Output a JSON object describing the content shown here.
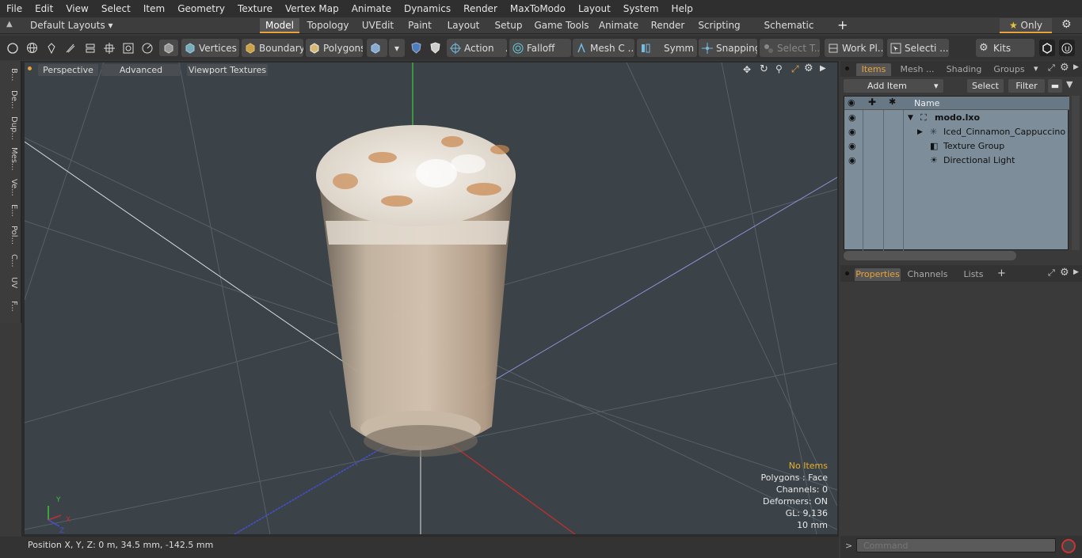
{
  "menu": [
    "File",
    "Edit",
    "View",
    "Select",
    "Item",
    "Geometry",
    "Texture",
    "Vertex Map",
    "Animate",
    "Dynamics",
    "Render",
    "MaxToModo",
    "Layout",
    "System",
    "Help"
  ],
  "layout": {
    "dropdown": "Default Layouts",
    "tabs": [
      "Model",
      "Topology",
      "UVEdit",
      "Paint",
      "Layout",
      "Setup",
      "Game Tools",
      "Animate",
      "Render",
      "Scripting",
      "Schematic Fusion"
    ],
    "active": "Model",
    "only": "Only"
  },
  "toolbar": {
    "vertices": "Vertices",
    "boundary": "Boundary",
    "polygons": "Polygons",
    "action": "Action",
    "action_ellipsis": "...",
    "falloff": "Falloff",
    "mesh": "Mesh C ...",
    "symm": "Symm ...",
    "snapping": "Snapping",
    "select_t": "Select T...",
    "workpl": "Work Pl...",
    "selecti": "Selecti ...",
    "kits": "Kits"
  },
  "lefttabs": [
    "B...",
    "De...",
    "Dup...",
    "Mes...",
    "Ve...",
    "E...",
    "Pol...",
    "C...",
    "UV",
    "F..."
  ],
  "viewport": {
    "perspective": "Perspective",
    "advanced": "Advanced",
    "textures": "Viewport Textures",
    "info": {
      "no_items": "No Items",
      "polygons": "Polygons : Face",
      "channels": "Channels: 0",
      "deformers": "Deformers: ON",
      "gl": "GL: 9,136",
      "scale": "10 mm"
    },
    "axis": {
      "y": "Y",
      "x": "X",
      "z": "Z"
    }
  },
  "status": {
    "position": "Position X, Y, Z:   0 m, 34.5 mm, -142.5 mm"
  },
  "items_panel": {
    "tabs": [
      "Items",
      "Mesh ...",
      "Shading",
      "Groups"
    ],
    "add_item": "Add Item",
    "select": "Select",
    "filter": "Filter",
    "name_header": "Name",
    "rows": [
      "modo.lxo",
      "Iced_Cinnamon_Cappuccino",
      "Texture Group",
      "Directional Light"
    ]
  },
  "props_panel": {
    "tabs": [
      "Properties",
      "Channels",
      "Lists"
    ]
  },
  "command": {
    "placeholder": "Command"
  },
  "colors": {
    "accent": "#e8a33a",
    "viewport": "#3b4349",
    "list": "#7d8d9a"
  }
}
